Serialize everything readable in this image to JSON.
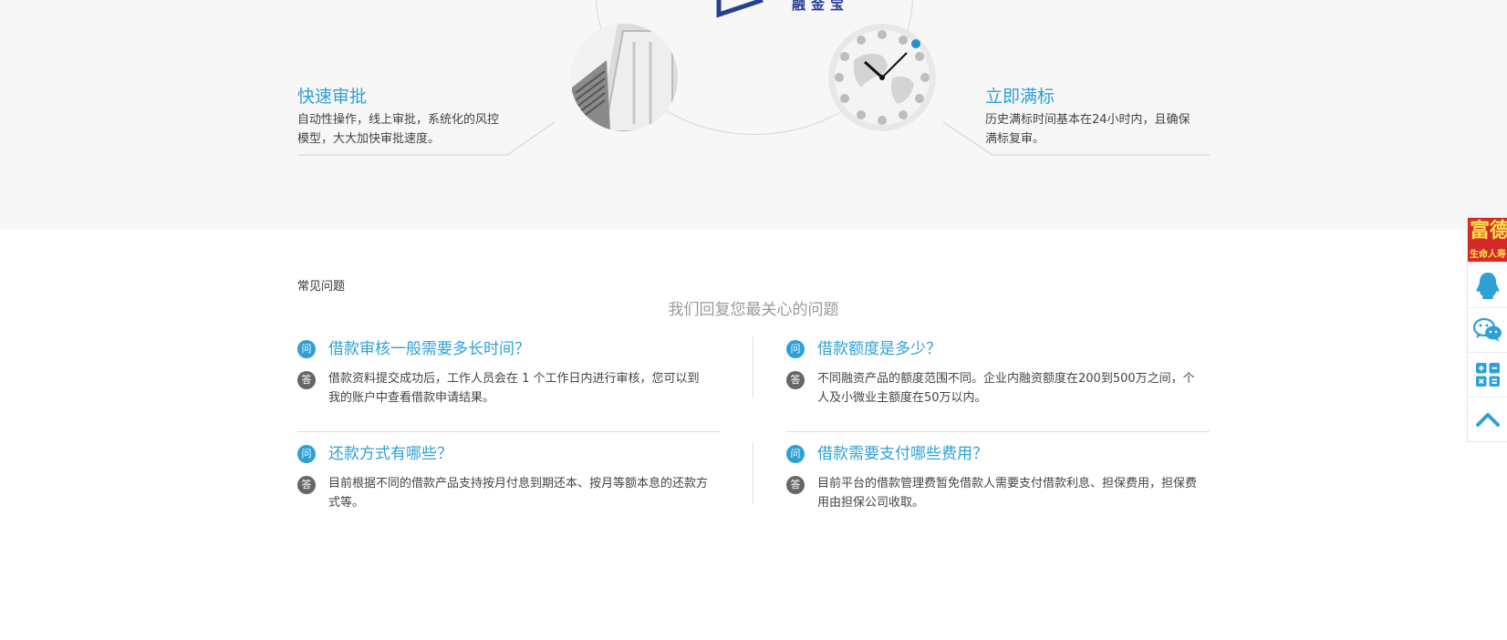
{
  "hero": {
    "brand_text": "融金宝",
    "features": [
      {
        "title": "快速审批",
        "desc_line1": "自动性操作，线上审批，系统化的风控",
        "desc_line2": "模型，大大加快审批速度。"
      },
      {
        "title": "立即满标",
        "desc_line1": "历史满标时间基本在24小时内，且确保",
        "desc_line2": "满标复审。"
      }
    ]
  },
  "faq": {
    "heading": "常见问题",
    "subheading": "我们回复您最关心的问题",
    "q_badge": "问",
    "a_badge": "答",
    "items": [
      {
        "question": "借款审核一般需要多长时间？",
        "answer_line1": "借款资料提交成功后，工作人员会在 1 个工作日内进行审核，您可以到",
        "answer_line2": "我的账户中查看借款申请结果。"
      },
      {
        "question": "借款额度是多少？",
        "answer_line1": "不同融资产品的额度范围不同。企业内融资额度在200到500万之间，个",
        "answer_line2": "人及小微业主额度在50万以内。"
      },
      {
        "question": "还款方式有哪些？",
        "answer_line1": "目前根据不同的借款产品支持按月付息到期还本、按月等额本息的还款方",
        "answer_line2": "式等。"
      },
      {
        "question": "借款需要支付哪些费用？",
        "answer_line1": "目前平台的借款管理费暂免借款人需要支付借款利息、担保费用，担保费",
        "answer_line2": "用由担保公司收取。"
      }
    ]
  },
  "sidebar": {
    "ad_main": "富德",
    "ad_sub": "生命人寿",
    "buttons": [
      {
        "icon": "qq-icon"
      },
      {
        "icon": "wechat-icon"
      },
      {
        "icon": "calculator-icon"
      },
      {
        "icon": "back-to-top-icon"
      }
    ]
  },
  "colors": {
    "accent": "#2fa0d6",
    "brand": "#2a3e8f",
    "ad_red": "#d52a2a",
    "ad_yellow": "#ffe14d"
  }
}
